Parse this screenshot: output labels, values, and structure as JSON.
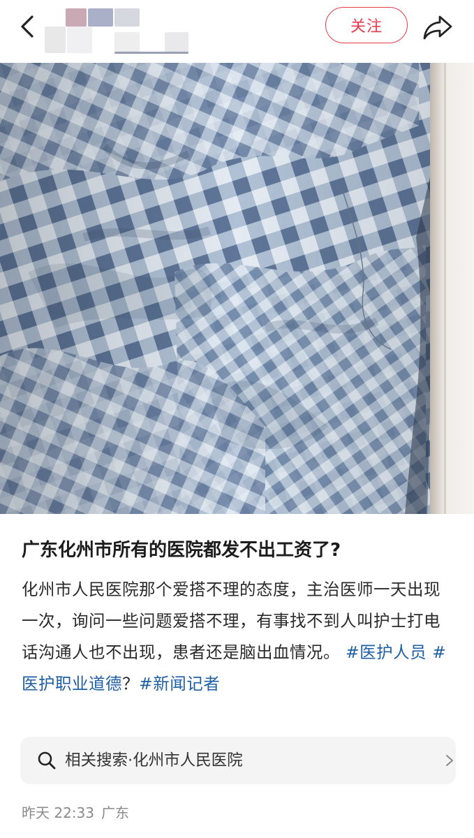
{
  "header": {
    "follow_label": "关注"
  },
  "post": {
    "title": "广东化州市所有的医院都发不出工资了?",
    "body": "化州市人民医院那个爱搭不理的态度，主治医师一天出现一次，询问一些问题爱搭不理，有事找不到人叫护士打电话沟通人也不出现，患者还是脑出血情况。",
    "tags": [
      "#医护人员",
      "#医护职业道德",
      "#新闻记者"
    ],
    "tag_separator": "？"
  },
  "related_search": {
    "label": "相关搜索·化州市人民医院"
  },
  "meta": {
    "time": "昨天 22:33",
    "location": "广东"
  },
  "icons": {
    "back": "chevron-left-icon",
    "share": "share-arrow-icon",
    "search": "search-icon",
    "chevron": "chevron-right-icon"
  },
  "colors": {
    "follow_accent": "#e83a4a",
    "tag_link": "#1f5fa6",
    "checker_dark": "#6e86a8",
    "checker_light": "#dce5ef"
  }
}
